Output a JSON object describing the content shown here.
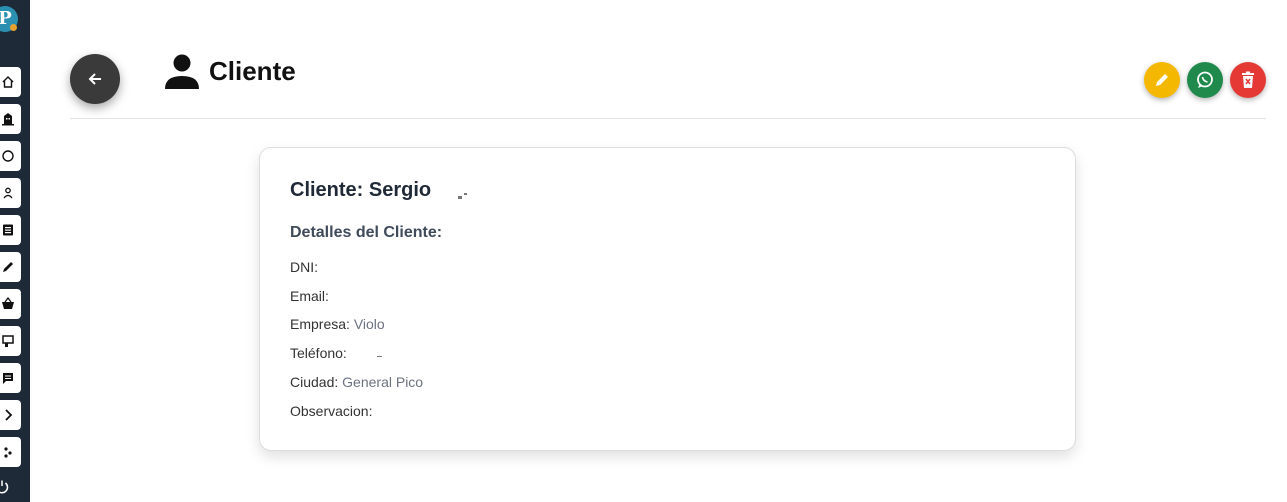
{
  "sidebar": {
    "logo_letter": "P",
    "items": [
      "home-icon",
      "building-icon",
      "info-icon",
      "users-icon",
      "list-icon",
      "edit-icon",
      "basket-icon",
      "printer-icon",
      "chat-icon",
      "chevron-right-icon",
      "share-icon"
    ],
    "power_icon": "power-icon"
  },
  "header": {
    "title": "Cliente",
    "actions": [
      {
        "name": "edit",
        "color": "#f5b800"
      },
      {
        "name": "whatsapp",
        "color": "#1f8a4c"
      },
      {
        "name": "delete",
        "color": "#e53935"
      }
    ]
  },
  "card": {
    "title": "Cliente: Sergio",
    "subtitle": "Detalles del Cliente:",
    "fields": {
      "dni_label": "DNI:",
      "email_label": "Email:",
      "empresa_label": "Empresa:",
      "empresa_value": "Violo",
      "telefono_label": "Teléfono:",
      "ciudad_label": "Ciudad:",
      "ciudad_value": "General Pico",
      "observacion_label": "Observacion:"
    }
  }
}
